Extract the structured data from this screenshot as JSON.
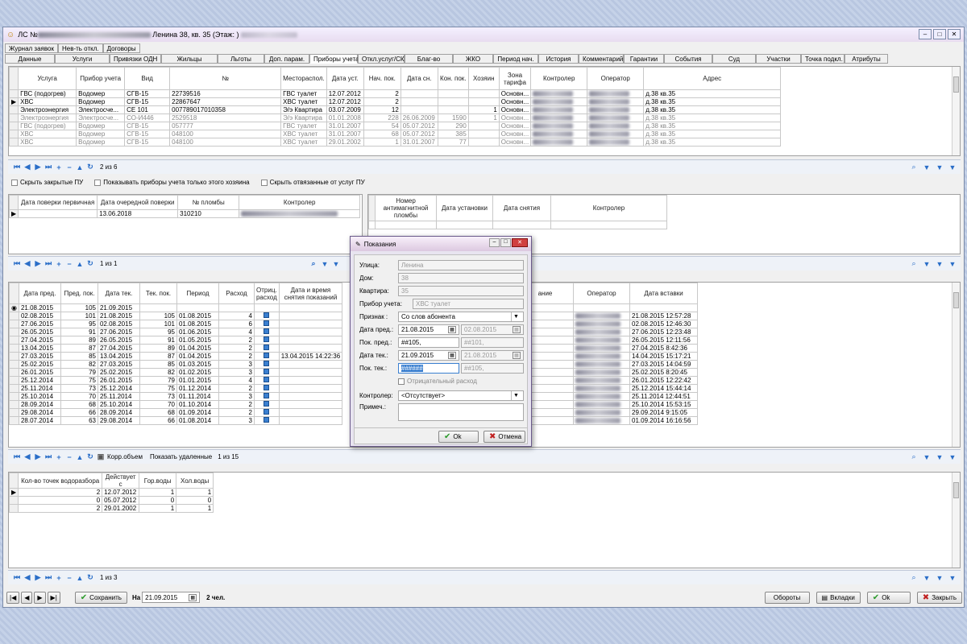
{
  "window": {
    "title_prefix": "ЛС №",
    "title_address": "Ленина 38, кв. 35 (Этаж: )"
  },
  "tabs_row1": [
    "Журнал заявок",
    "Нев-ть откл.",
    "Договоры"
  ],
  "tabs_row2": [
    "Данные",
    "Услуги",
    "Привязки ОДН",
    "Жильцы",
    "Льготы",
    "Доп. парам.",
    "Приборы учета",
    "Откл.услуг/СКУ",
    "Благ-во",
    "ЖКО",
    "Период нач.",
    "История",
    "Комментарий",
    "Гарантии",
    "События",
    "Суд",
    "Участки",
    "Точка подкл.",
    "Атрибуты"
  ],
  "meters": {
    "headers": [
      "Услуга",
      "Прибор учета",
      "Вид",
      "№",
      "Местораспол.",
      "Дата уст.",
      "Нач. пок.",
      "Дата сн.",
      "Кон. пок.",
      "Хозяин",
      "Зона тарифа",
      "Контролер",
      "Оператор",
      "Адрес"
    ],
    "rows": [
      {
        "c": [
          "ГВС (подогрев)",
          "Водомер",
          "СГВ-15",
          "22739516",
          "ГВС туалет",
          "12.07.2012",
          "2",
          "",
          "",
          "",
          "Основн...",
          "",
          "",
          "д.38 кв.35"
        ],
        "grey": false
      },
      {
        "c": [
          "ХВС",
          "Водомер",
          "СГВ-15",
          "22867647",
          "ХВС туалет",
          "12.07.2012",
          "2",
          "",
          "",
          "",
          "Основн...",
          "",
          "",
          "д.38 кв.35"
        ],
        "grey": false
      },
      {
        "c": [
          "Электроэнергия",
          "Электросче...",
          "СЕ 101",
          "007789017010358",
          "Э/э Квартира",
          "03.07.2009",
          "12",
          "",
          "",
          "1",
          "Основн...",
          "",
          "",
          "д.38 кв.35"
        ],
        "grey": false
      },
      {
        "c": [
          "Электроэнергия",
          "Электросче...",
          "СО-И446",
          "2529518",
          "Э/э Квартира",
          "01.01.2008",
          "228",
          "26.06.2009",
          "1590",
          "1",
          "Основн...",
          "",
          "",
          "д.38 кв.35"
        ],
        "grey": true
      },
      {
        "c": [
          "ГВС (подогрев)",
          "Водомер",
          "СГВ-15",
          "057777",
          "ГВС туалет",
          "31.01.2007",
          "54",
          "05.07.2012",
          "290",
          "",
          "Основн...",
          "",
          "",
          "д.38 кв.35"
        ],
        "grey": true
      },
      {
        "c": [
          "ХВС",
          "Водомер",
          "СГВ-15",
          "048100",
          "ХВС туалет",
          "31.01.2007",
          "68",
          "05.07.2012",
          "385",
          "",
          "Основн...",
          "",
          "",
          "д.38 кв.35"
        ],
        "grey": true
      },
      {
        "c": [
          "ХВС",
          "Водомер",
          "СГВ-15",
          "048100",
          "ХВС туалет",
          "29.01.2002",
          "1",
          "31.01.2007",
          "77",
          "",
          "Основн...",
          "",
          "",
          "д.38 кв.35"
        ],
        "grey": true
      }
    ],
    "nav": "2 из 6"
  },
  "options": [
    "Скрыть закрытые ПУ",
    "Показывать приборы учета только этого хозяина",
    "Скрыть отвязанные от услуг ПУ"
  ],
  "verify": {
    "headers": [
      "Дата поверки первичная",
      "Дата очередной поверки",
      "№ пломбы",
      "Контролер"
    ],
    "row": [
      "",
      "13.06.2018",
      "310210",
      ""
    ],
    "nav": "1 из 1"
  },
  "seals": {
    "headers": [
      "Номер антимагнитной пломбы",
      "Дата установки",
      "Дата снятия",
      "Контролер"
    ]
  },
  "readings": {
    "headers": [
      "Дата пред.",
      "Пред. пок.",
      "Дата тек.",
      "Тек. пок.",
      "Период",
      "Расход",
      "Отриц. расход",
      "Дата и время снятия показаний"
    ],
    "right_headers": [
      "ание",
      "Оператор",
      "Дата вставки"
    ],
    "rows": [
      [
        "21.08.2015",
        "105",
        "21.09.2015",
        "",
        "",
        "",
        "",
        ""
      ],
      [
        "02.08.2015",
        "101",
        "21.08.2015",
        "105",
        "01.08.2015",
        "4",
        "",
        ""
      ],
      [
        "27.06.2015",
        "95",
        "02.08.2015",
        "101",
        "01.08.2015",
        "6",
        "",
        ""
      ],
      [
        "26.05.2015",
        "91",
        "27.06.2015",
        "95",
        "01.06.2015",
        "4",
        "",
        ""
      ],
      [
        "27.04.2015",
        "89",
        "26.05.2015",
        "91",
        "01.05.2015",
        "2",
        "",
        ""
      ],
      [
        "13.04.2015",
        "87",
        "27.04.2015",
        "89",
        "01.04.2015",
        "2",
        "",
        ""
      ],
      [
        "27.03.2015",
        "85",
        "13.04.2015",
        "87",
        "01.04.2015",
        "2",
        "",
        "13.04.2015 14:22:36"
      ],
      [
        "25.02.2015",
        "82",
        "27.03.2015",
        "85",
        "01.03.2015",
        "3",
        "",
        ""
      ],
      [
        "26.01.2015",
        "79",
        "25.02.2015",
        "82",
        "01.02.2015",
        "3",
        "",
        ""
      ],
      [
        "25.12.2014",
        "75",
        "26.01.2015",
        "79",
        "01.01.2015",
        "4",
        "",
        ""
      ],
      [
        "25.11.2014",
        "73",
        "25.12.2014",
        "75",
        "01.12.2014",
        "2",
        "",
        ""
      ],
      [
        "25.10.2014",
        "70",
        "25.11.2014",
        "73",
        "01.11.2014",
        "3",
        "",
        ""
      ],
      [
        "28.09.2014",
        "68",
        "25.10.2014",
        "70",
        "01.10.2014",
        "2",
        "",
        ""
      ],
      [
        "29.08.2014",
        "66",
        "28.09.2014",
        "68",
        "01.09.2014",
        "2",
        "",
        ""
      ],
      [
        "28.07.2014",
        "63",
        "29.08.2014",
        "66",
        "01.08.2014",
        "3",
        "",
        ""
      ]
    ],
    "insert_dates": [
      "21.08.2015 12:57:28",
      "02.08.2015 12:46:30",
      "27.06.2015 12:23:48",
      "26.05.2015 12:11:56",
      "27.04.2015 8:42:36",
      "14.04.2015 15:17:21",
      "27.03.2015 14:04:59",
      "25.02.2015 8:20:45",
      "26.01.2015 12:22:42",
      "25.12.2014 15:44:14",
      "25.11.2014 12:44:51",
      "25.10.2014 15:53:15",
      "29.09.2014 9:15:05",
      "01.09.2014 16:16:56"
    ],
    "corr_label": "Корр.объем",
    "show_deleted": "Показать удаленные",
    "nav": "1 из 15"
  },
  "points": {
    "headers": [
      "Кол-во точек водоразбора",
      "Действует с",
      "Гор.воды",
      "Хол.воды"
    ],
    "rows": [
      [
        "2",
        "12.07.2012",
        "1",
        "1"
      ],
      [
        "0",
        "05.07.2012",
        "0",
        "0"
      ],
      [
        "2",
        "29.01.2002",
        "1",
        "1"
      ]
    ],
    "nav": "1 из 3"
  },
  "footer": {
    "save": "Сохранить",
    "on_label": "На",
    "date": "21.09.2015",
    "people": "2 чел.",
    "oboroty": "Обороты",
    "vkladki": "Вкладки",
    "ok": "Ok",
    "close": "Закрыть"
  },
  "dialog": {
    "title": "Показания",
    "street_label": "Улица:",
    "street": "Ленина",
    "house_label": "Дом:",
    "house": "38",
    "flat_label": "Квартира:",
    "flat": "35",
    "meter_label": "Прибор учета:",
    "meter": "ХВС туалет",
    "sign_label": "Признак :",
    "sign": "Со слов абонента",
    "prev_date_label": "Дата пред.:",
    "prev_date": "21.08.2015",
    "prev_date2": "02.08.2015",
    "prev_val_label": "Пок. пред.:",
    "prev_val": "##105,",
    "prev_val2": "##101,",
    "cur_date_label": "Дата тек.:",
    "cur_date": "21.09.2015",
    "cur_date2": "21.08.2015",
    "cur_val_label": "Пок. тек.:",
    "cur_val": "######",
    "cur_val2": "##105,",
    "negative": "Отрицательный расход",
    "controller_label": "Контролер:",
    "controller": "<Отсутствует>",
    "note_label": "Примеч.:",
    "ok": "Ok",
    "cancel": "Отмена"
  }
}
